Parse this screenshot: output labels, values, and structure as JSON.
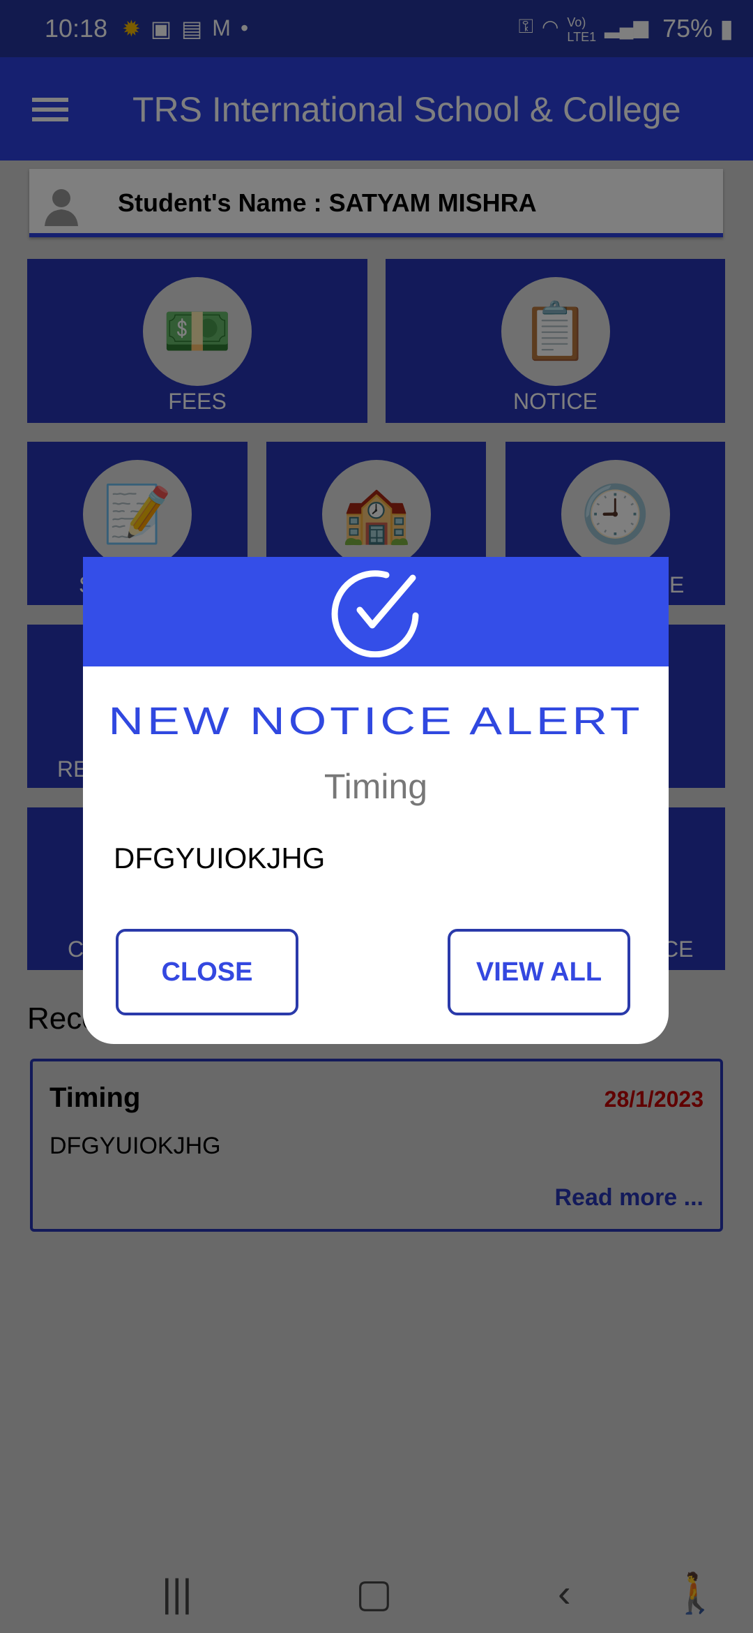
{
  "status_bar": {
    "time": "10:18",
    "battery": "75%",
    "notification_icons": [
      "app-icon",
      "contacts-icon",
      "shopping-icon",
      "gmail-icon"
    ],
    "system_icons": [
      "vpn-key-icon",
      "wifi-icon",
      "volte-lte-icon",
      "signal-icon"
    ]
  },
  "app_bar": {
    "title": "TRS International School & College",
    "menu_icon": "hamburger-icon"
  },
  "student": {
    "label": "Student's Name : SATYAM MISHRA"
  },
  "tiles": {
    "fees": "FEES",
    "notice": "NOTICE",
    "row2_left_fragment": "S",
    "row2_right_fragment": "E",
    "row3_left_fragment": "RE",
    "row4_left_fragment": "C",
    "row4_right_fragment": "CE"
  },
  "recent": {
    "heading_fragment": "Rece"
  },
  "notice_card": {
    "title": "Timing",
    "date": "28/1/2023",
    "body": "DFGYUIOKJHG",
    "read_more": "Read more ..."
  },
  "dialog": {
    "title": "NEW NOTICE ALERT",
    "subtitle": "Timing",
    "body": "DFGYUIOKJHG",
    "close": "CLOSE",
    "view_all": "VIEW ALL"
  },
  "colors": {
    "primary": "#2c40e0",
    "dialog_header": "#344ee8",
    "date": "#c00000"
  }
}
